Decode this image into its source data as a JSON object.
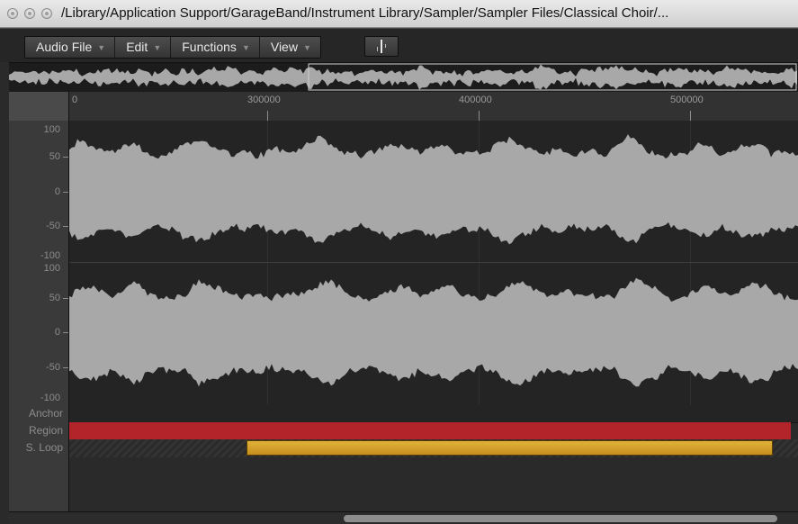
{
  "window": {
    "title": "/Library/Application Support/GarageBand/Instrument Library/Sampler/Sampler Files/Classical Choir/..."
  },
  "menu": {
    "items": [
      {
        "label": "Audio File"
      },
      {
        "label": "Edit"
      },
      {
        "label": "Functions"
      },
      {
        "label": "View"
      }
    ],
    "arrow_glyph": "▼",
    "snap_icon": "waveform-snap-icon"
  },
  "ruler": {
    "ticks": [
      "0",
      "300000",
      "400000",
      "500000"
    ]
  },
  "channels": [
    {
      "scale": [
        "100",
        "50",
        "0",
        "-50",
        "-100"
      ]
    },
    {
      "scale": [
        "100",
        "50",
        "0",
        "-50",
        "-100"
      ]
    }
  ],
  "markers": {
    "rows": [
      {
        "label": "Anchor"
      },
      {
        "label": "Region"
      },
      {
        "label": "S. Loop"
      }
    ]
  },
  "colors": {
    "region": "#b2232a",
    "sustain_loop": "#d9a632",
    "waveform": "#a8a8a8"
  }
}
